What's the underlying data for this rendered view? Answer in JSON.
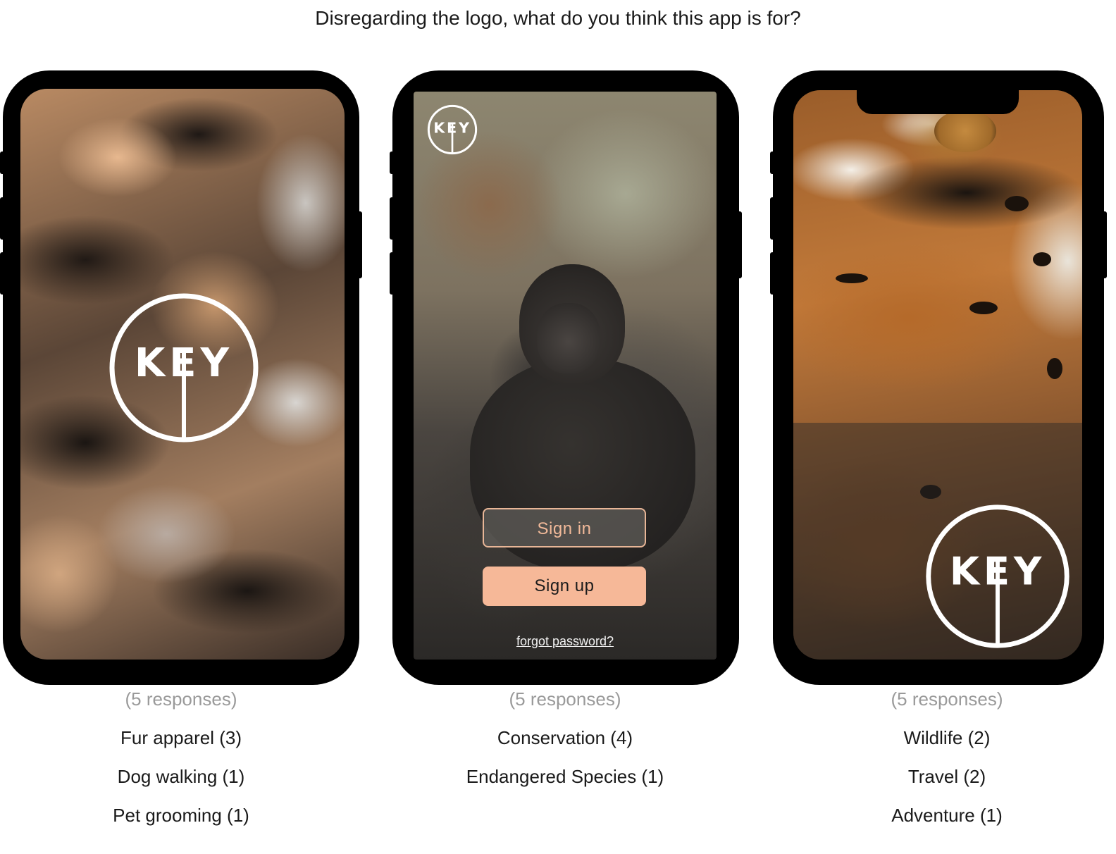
{
  "question": "Disregarding the logo, what do you think this app is for?",
  "brand": {
    "logo_text": "KEY",
    "accent": "#f6b898"
  },
  "phones": [
    {
      "responses": "(5 responses)",
      "answers": [
        "Fur apparel (3)",
        "Dog walking (1)",
        "Pet grooming (1)"
      ]
    },
    {
      "responses": "(5 responses)",
      "answers": [
        "Conservation (4)",
        "Endangered Species (1)"
      ],
      "sign_in": "Sign in",
      "sign_up": "Sign up",
      "forgot": "forgot password?"
    },
    {
      "responses": "(5 responses)",
      "answers": [
        "Wildlife (2)",
        "Travel (2)",
        "Adventure (1)"
      ]
    }
  ]
}
